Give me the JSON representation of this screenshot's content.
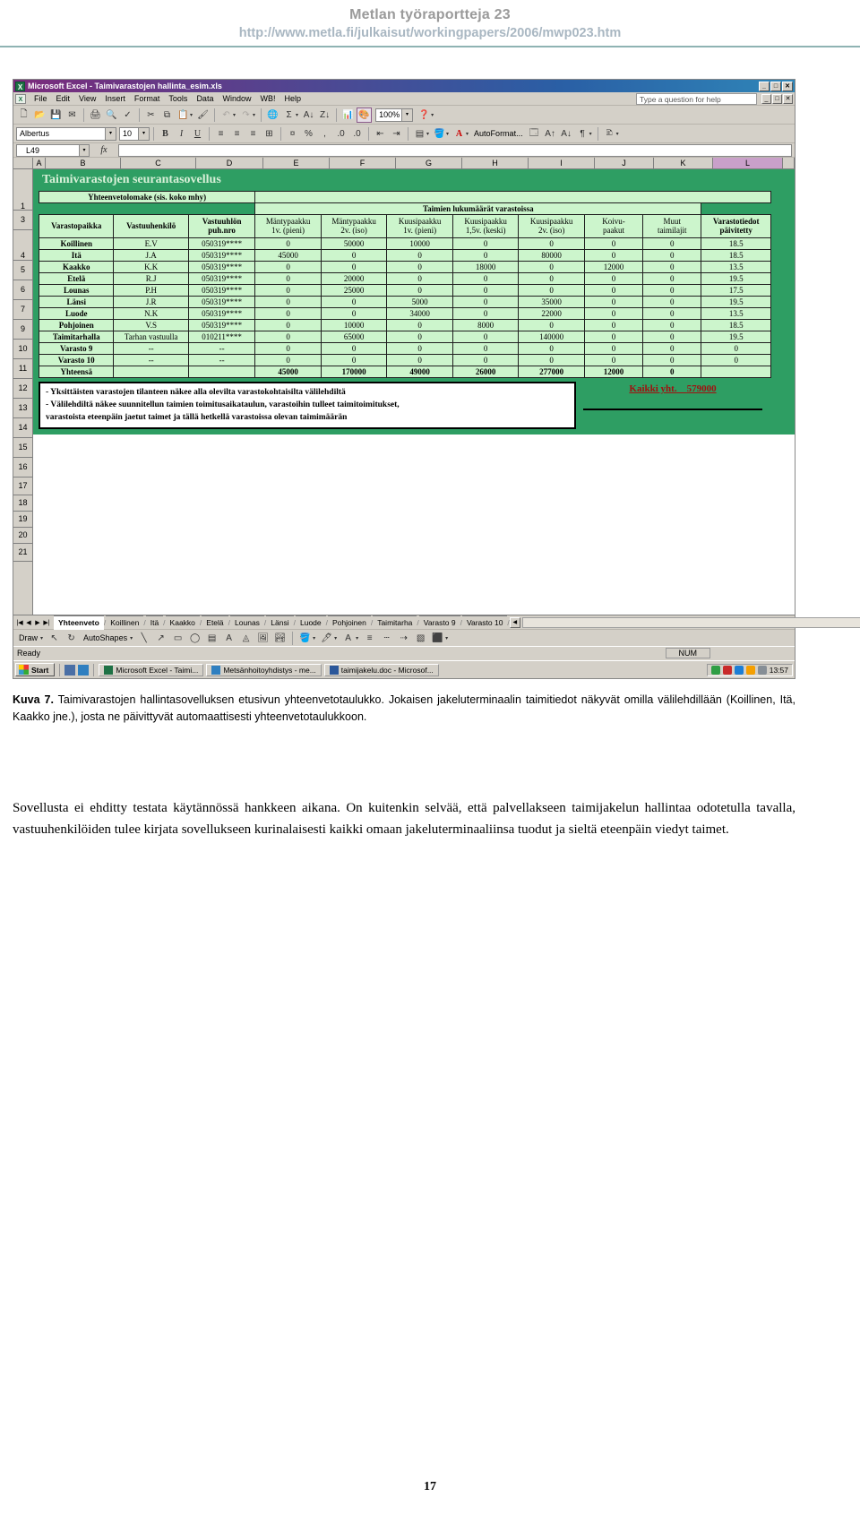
{
  "page_header": {
    "title": "Metlan työraportteja 23",
    "url": "http://www.metla.fi/julkaisut/workingpapers/2006/mwp023.htm"
  },
  "excel": {
    "title": "Microsoft Excel - Taimivarastojen hallinta_esim.xls",
    "menu": [
      "File",
      "Edit",
      "View",
      "Insert",
      "Format",
      "Tools",
      "Data",
      "Window",
      "WB!",
      "Help"
    ],
    "help_box": "Type a question for help",
    "zoom": "100%",
    "font_name": "Albertus",
    "font_size": "10",
    "autoformat_label": "AutoFormat...",
    "name_box": "L49",
    "formula_text": "",
    "columns": [
      "A",
      "B",
      "C",
      "D",
      "E",
      "F",
      "G",
      "H",
      "I",
      "J",
      "K",
      "L"
    ],
    "active_column": "L",
    "rows": [
      "1",
      "3",
      "4",
      "5",
      "6",
      "7",
      "9",
      "10",
      "11",
      "12",
      "13",
      "14",
      "15",
      "16",
      "17",
      "18",
      "19",
      "20",
      "21"
    ],
    "banner": "Taimivarastojen seurantasovellus",
    "form_title": "Yhteenvetolomake (sis. koko mhy)",
    "group_header": "Taimien lukumäärät varastoissa",
    "headers": [
      {
        "line1": "Varastopaikka",
        "line2": ""
      },
      {
        "line1": "Vastuuhenkilö",
        "line2": ""
      },
      {
        "line1": "Vastuuhlön",
        "line2": "puh.nro"
      },
      {
        "line1": "Mäntypaakku",
        "line2": "1v. (pieni)"
      },
      {
        "line1": "Mäntypaakku",
        "line2": "2v. (iso)"
      },
      {
        "line1": "Kuusipaakku",
        "line2": "1v. (pieni)"
      },
      {
        "line1": "Kuusipaakku",
        "line2": "1,5v. (keski)"
      },
      {
        "line1": "Kuusipaakku",
        "line2": "2v. (iso)"
      },
      {
        "line1": "Koivu-",
        "line2": "paakut"
      },
      {
        "line1": "Muut",
        "line2": "taimilajit"
      },
      {
        "line1": "Varastotiedot",
        "line2": "päivitetty"
      }
    ],
    "rows_data": [
      [
        "Koillinen",
        "E.V",
        "050319****",
        "0",
        "50000",
        "10000",
        "0",
        "0",
        "0",
        "0",
        "18.5"
      ],
      [
        "Itä",
        "J.A",
        "050319****",
        "45000",
        "0",
        "0",
        "0",
        "80000",
        "0",
        "0",
        "18.5"
      ],
      [
        "Kaakko",
        "K.K",
        "050319****",
        "0",
        "0",
        "0",
        "18000",
        "0",
        "12000",
        "0",
        "13.5"
      ],
      [
        "Etelä",
        "R.J",
        "050319****",
        "0",
        "20000",
        "0",
        "0",
        "0",
        "0",
        "0",
        "19.5"
      ],
      [
        "Lounas",
        "P.H",
        "050319****",
        "0",
        "25000",
        "0",
        "0",
        "0",
        "0",
        "0",
        "17.5"
      ],
      [
        "Länsi",
        "J.R",
        "050319****",
        "0",
        "0",
        "5000",
        "0",
        "35000",
        "0",
        "0",
        "19.5"
      ],
      [
        "Luode",
        "N.K",
        "050319****",
        "0",
        "0",
        "34000",
        "0",
        "22000",
        "0",
        "0",
        "13.5"
      ],
      [
        "Pohjoinen",
        "V.S",
        "050319****",
        "0",
        "10000",
        "0",
        "8000",
        "0",
        "0",
        "0",
        "18.5"
      ],
      [
        "Taimitarhalla",
        "Tarhan vastuulla",
        "010211****",
        "0",
        "65000",
        "0",
        "0",
        "140000",
        "0",
        "0",
        "19.5"
      ],
      [
        "Varasto 9",
        "--",
        "--",
        "0",
        "0",
        "0",
        "0",
        "0",
        "0",
        "0",
        "0"
      ],
      [
        "Varasto 10",
        "--",
        "--",
        "0",
        "0",
        "0",
        "0",
        "0",
        "0",
        "0",
        "0"
      ]
    ],
    "total_row": [
      "Yhteensä",
      "",
      "",
      "45000",
      "170000",
      "49000",
      "26000",
      "277000",
      "12000",
      "0",
      ""
    ],
    "note_lines": [
      "- Yksittäisten varastojen tilanteen näkee alla olevilta varastokohtaisilta välilehdiltä",
      "- Välilehdiltä näkee suunnitellun taimien toimitusaikataulun, varastoihin tulleet taimitoimitukset,",
      "  varastoista eteenpäin jaetut taimet ja tällä hetkellä varastoissa olevan taimimäärän"
    ],
    "grand_total_label": "Kaikki yht.",
    "grand_total_value": "579000",
    "sheet_tabs": [
      "Yhteenveto",
      "Koillinen",
      "Itä",
      "Kaakko",
      "Etelä",
      "Lounas",
      "Länsi",
      "Luode",
      "Pohjoinen",
      "Taimitarha",
      "Varasto 9",
      "Varasto 10"
    ],
    "active_sheet": "Yhteenveto",
    "draw_label": "Draw",
    "autoshapes_label": "AutoShapes",
    "status_text": "Ready",
    "status_num": "NUM"
  },
  "taskbar": {
    "start": "Start",
    "apps": [
      "Microsoft Excel - Taimi...",
      "Metsänhoitoyhdistys - me...",
      "taimijakelu.doc - Microsof..."
    ],
    "clock": "13:57"
  },
  "caption": {
    "label": "Kuva 7.",
    "text": " Taimivarastojen hallintasovelluksen etusivun yhteenvetotaulukko. Jokaisen jakeluterminaalin taimitiedot näkyvät omilla välilehdillään (Koillinen, Itä, Kaakko jne.), josta ne päivittyvät automaattisesti yhteenvetotaulukkoon."
  },
  "paragraph": "Sovellusta ei ehditty testata käytännössä hankkeen aikana. On kuitenkin selvää, että palvellakseen taimijakelun hallintaa odotetulla tavalla, vastuuhenkilöiden tulee kirjata sovellukseen kurinalaisesti kaikki omaan jakeluterminaaliinsa tuodut ja sieltä eteenpäin viedyt taimet.",
  "page_number": "17"
}
